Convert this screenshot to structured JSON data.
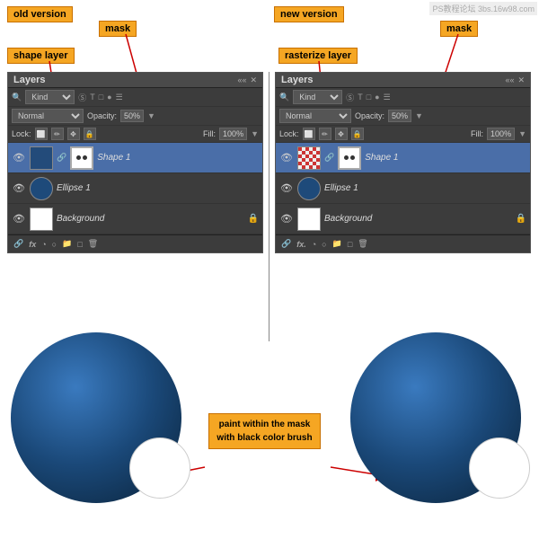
{
  "left_panel": {
    "version_label": "old version",
    "mask_label": "mask",
    "shape_label": "shape layer",
    "title": "Layers",
    "kind_value": "Kind",
    "blend_mode": "Normal",
    "opacity_label": "Opacity:",
    "opacity_value": "50%",
    "lock_label": "Lock:",
    "fill_label": "Fill:",
    "fill_value": "100%",
    "layers": [
      {
        "name": "Shape 1",
        "type": "shape",
        "selected": true
      },
      {
        "name": "Ellipse 1",
        "type": "ellipse",
        "selected": false
      },
      {
        "name": "Background",
        "type": "background",
        "selected": false,
        "locked": true
      }
    ],
    "footer_icons": [
      "link",
      "fx",
      "mask",
      "new_group",
      "new_layer",
      "delete"
    ]
  },
  "right_panel": {
    "version_label": "new version",
    "mask_label": "mask",
    "rasterize_label": "rasterize layer",
    "title": "Layers",
    "kind_value": "Kind",
    "blend_mode": "Normal",
    "opacity_label": "Opacity:",
    "opacity_value": "50%",
    "lock_label": "Lock:",
    "fill_label": "Fill:",
    "fill_value": "100%",
    "layers": [
      {
        "name": "Shape 1",
        "type": "shape_rasterized",
        "selected": true
      },
      {
        "name": "Ellipse 1",
        "type": "ellipse_small",
        "selected": false
      },
      {
        "name": "Background",
        "type": "background",
        "selected": false,
        "locked": true
      }
    ]
  },
  "bottom": {
    "paint_label": "paint within\nthe mask\nwith black\ncolor brush"
  },
  "watermark": "PS教程论坛\n3bs.16w98.com"
}
